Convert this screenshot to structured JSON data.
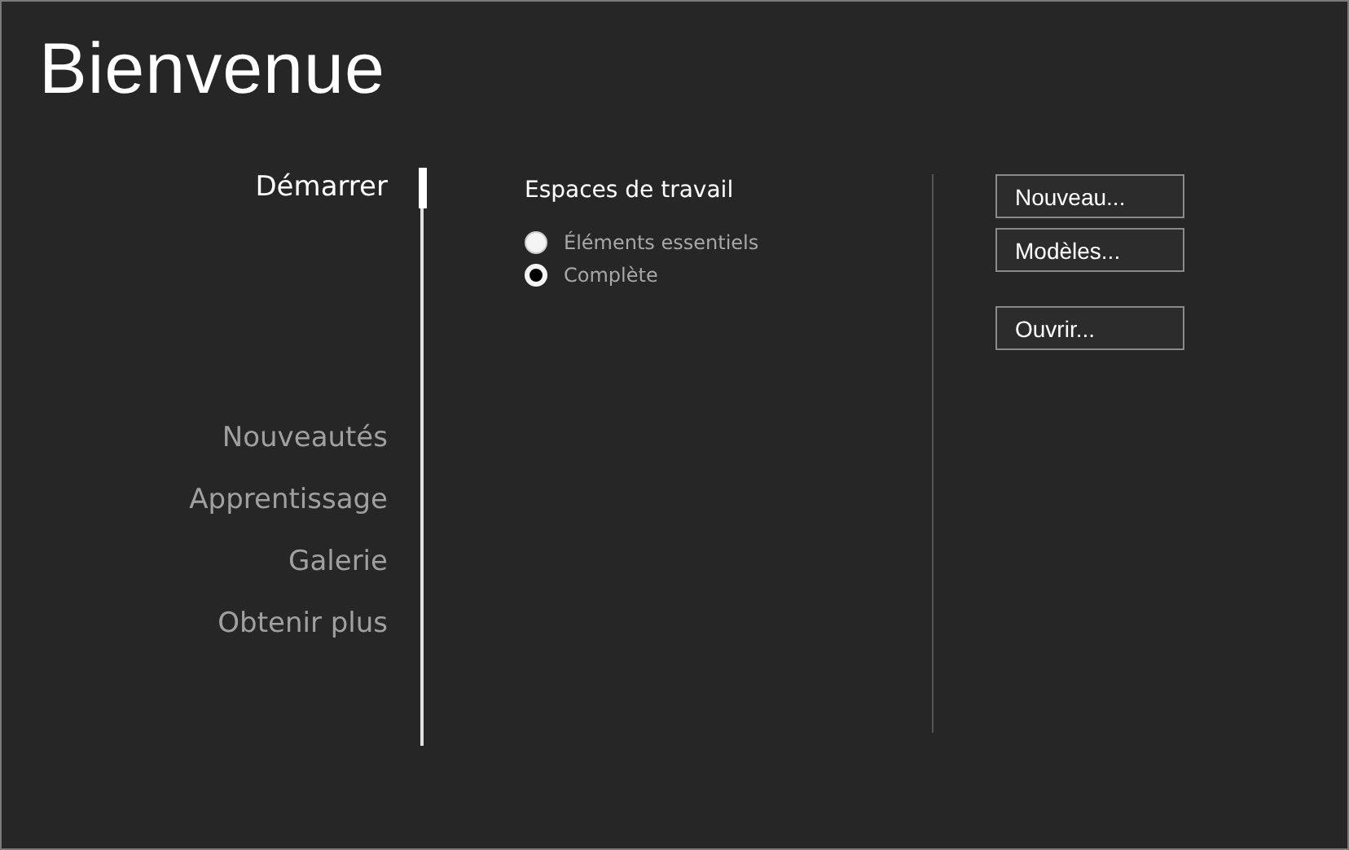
{
  "title": "Bienvenue",
  "nav": [
    {
      "items": [
        {
          "label": "Démarrer",
          "selected": true
        }
      ]
    },
    {
      "items": [
        {
          "label": "Nouveautés",
          "selected": false
        },
        {
          "label": "Apprentissage",
          "selected": false
        },
        {
          "label": "Galerie",
          "selected": false
        },
        {
          "label": "Obtenir plus",
          "selected": false
        }
      ]
    }
  ],
  "workspaces": {
    "heading": "Espaces de travail",
    "options": [
      {
        "label": "Éléments essentiels",
        "selected": false
      },
      {
        "label": "Complète",
        "selected": true
      }
    ]
  },
  "button_groups": [
    [
      "Nouveau...",
      "Modèles..."
    ],
    [
      "Ouvrir..."
    ]
  ]
}
